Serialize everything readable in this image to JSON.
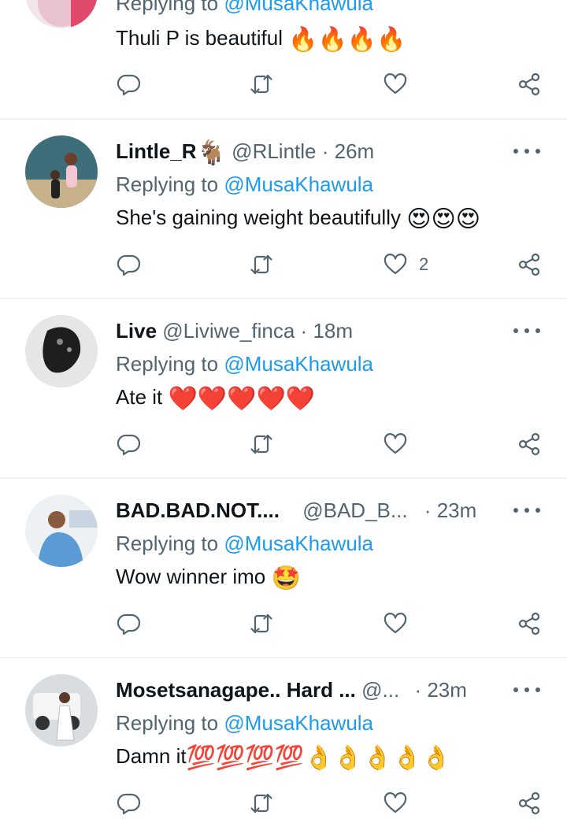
{
  "tweets": [
    {
      "name": "",
      "handle": "",
      "dot": "",
      "time": "",
      "replying_prefix": "Replying to",
      "replying_mention": "@MusaKhawula",
      "text": "Thuli P is beautiful",
      "text_emoji": "🔥🔥🔥🔥",
      "likes": ""
    },
    {
      "name": "Lintle_R",
      "name_emoji": "🐐",
      "handle": "@RLintle",
      "dot": "·",
      "time": "26m",
      "replying_prefix": "Replying to",
      "replying_mention": "@MusaKhawula",
      "text": "She's gaining weight beautifully",
      "text_emoji": "😍😍😍",
      "likes": "2"
    },
    {
      "name": "Live",
      "handle": "@Liviwe_finca",
      "dot": "·",
      "time": "18m",
      "replying_prefix": "Replying to",
      "replying_mention": "@MusaKhawula",
      "text": "Ate it",
      "text_emoji": "❤️❤️❤️❤️❤️",
      "likes": ""
    },
    {
      "name": "BAD.BAD.NOT....",
      "handle": "@BAD_B...",
      "dot": "·",
      "time": "23m",
      "replying_prefix": "Replying to",
      "replying_mention": "@MusaKhawula",
      "text": "Wow winner imo",
      "text_emoji": "🤩",
      "likes": ""
    },
    {
      "name": "Mosetsanagape.. Hard ...",
      "handle": "@...",
      "dot": "·",
      "time": "23m",
      "replying_prefix": "Replying to",
      "replying_mention": "@MusaKhawula",
      "text": "Damn it",
      "text_emoji": "💯💯💯💯👌👌👌👌👌",
      "likes": ""
    }
  ],
  "icons": {
    "reply": "reply-icon",
    "retweet": "retweet-icon",
    "like": "heart-icon",
    "share": "share-icon",
    "more": "more-icon"
  },
  "colors": {
    "mention": "#1d9bf0",
    "secondary_text": "#536471",
    "divider": "#eff3f4"
  }
}
